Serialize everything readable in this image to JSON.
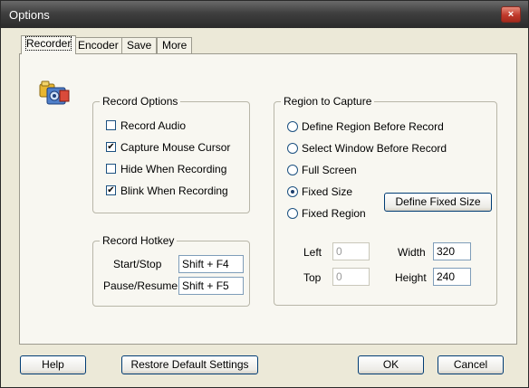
{
  "window": {
    "title": "Options",
    "close_glyph": "×"
  },
  "tabs": [
    "Recorder",
    "Encoder",
    "Save",
    "More"
  ],
  "record_options": {
    "legend": "Record Options",
    "items": [
      {
        "label": "Record Audio",
        "checked": false
      },
      {
        "label": "Capture Mouse Cursor",
        "checked": true
      },
      {
        "label": "Hide When Recording",
        "checked": false
      },
      {
        "label": "Blink When Recording",
        "checked": true
      }
    ],
    "check_glyph": "✔"
  },
  "record_hotkey": {
    "legend": "Record Hotkey",
    "start_stop_label": "Start/Stop",
    "start_stop_value": "Shift + F4",
    "pause_resume_label": "Pause/Resume:",
    "pause_resume_value": "Shift + F5"
  },
  "region": {
    "legend": "Region to Capture",
    "options": [
      {
        "label": "Define Region Before Record",
        "selected": false
      },
      {
        "label": "Select Window Before Record",
        "selected": false
      },
      {
        "label": "Full Screen",
        "selected": false
      },
      {
        "label": "Fixed Size",
        "selected": true
      },
      {
        "label": "Fixed Region",
        "selected": false
      }
    ],
    "define_fixed_size_label": "Define Fixed Size",
    "left_label": "Left",
    "left_value": "0",
    "top_label": "Top",
    "top_value": "0",
    "width_label": "Width",
    "width_value": "320",
    "height_label": "Height",
    "height_value": "240"
  },
  "footer": {
    "help": "Help",
    "restore": "Restore Default Settings",
    "ok": "OK",
    "cancel": "Cancel"
  },
  "colors": {
    "face": "#ece9d8",
    "panel": "#f8f7f1",
    "border": "#b8b6a8"
  }
}
